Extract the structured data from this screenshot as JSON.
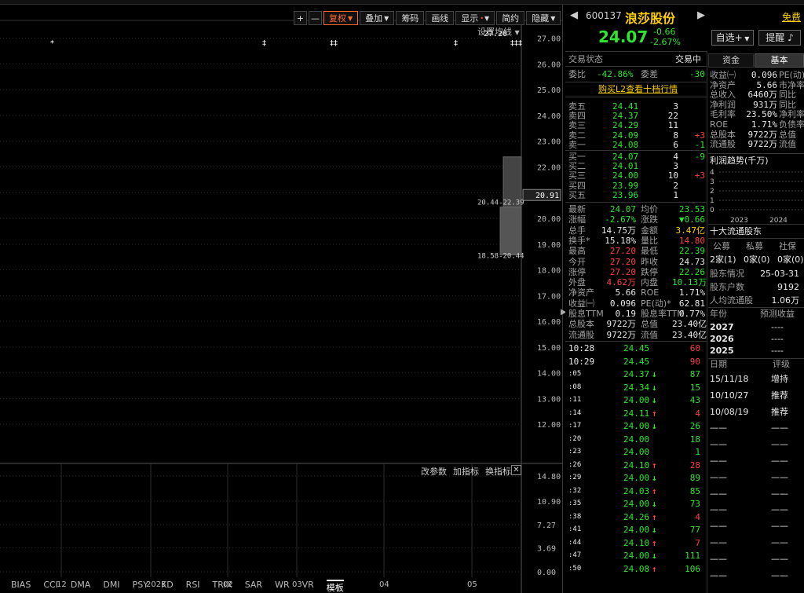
{
  "toolbar": {
    "plus": "+",
    "minus": "—",
    "buttons": [
      "复权",
      "叠加",
      "筹码",
      "画线",
      "显示",
      "简约",
      "隐藏"
    ],
    "settings_label": "设置均线"
  },
  "kline": {
    "ymin": 11.0,
    "ymax": 27.6,
    "y_ticks": [
      "27.00",
      "26.00",
      "25.00",
      "24.00",
      "23.00",
      "22.00",
      "21.00",
      "20.00",
      "19.00",
      "18.00",
      "17.00",
      "16.00",
      "15.00",
      "14.00",
      "13.00",
      "12.00"
    ],
    "current_price_tag": "20.91",
    "annotations": {
      "high": "27.20",
      "mid": "20.44-22.39",
      "low": "18.58-20.44"
    },
    "markers": [
      "*",
      "‡",
      "‡‡",
      "‡",
      "‡‡‡"
    ],
    "x_labels": [
      "12",
      "2025",
      "02",
      "03",
      "04",
      "05"
    ],
    "candles": []
  },
  "volume": {
    "ymax": 14.8,
    "y_ticks": [
      "14.80",
      "10.90",
      "7.27",
      "3.69",
      "0.00"
    ],
    "toolbar": [
      "改参数",
      "加指标",
      "换指标"
    ]
  },
  "indicator_tabs": [
    "BIAS",
    "CCI",
    "DMA",
    "DMI",
    "PSY",
    "KD",
    "RSI",
    "TRIX",
    "SAR",
    "WR",
    "VR",
    "模板"
  ],
  "stock": {
    "code": "600137",
    "name": "浪莎股份",
    "free_label": "免费",
    "price": "24.07",
    "change": "-0.66",
    "change_pct": "-2.67%",
    "btn_watch": "自选+",
    "btn_alert": "提醒"
  },
  "status": {
    "label": "交易状态",
    "value": "交易中"
  },
  "weibi": {
    "label1": "委比",
    "value1": "-42.86%",
    "label2": "委差",
    "value2": "-30"
  },
  "l2_link": "购买L2查看十档行情",
  "asks": [
    {
      "label": "卖五",
      "price": "24.41",
      "vol": "3",
      "chg": ""
    },
    {
      "label": "卖四",
      "price": "24.37",
      "vol": "22",
      "chg": ""
    },
    {
      "label": "卖三",
      "price": "24.29",
      "vol": "11",
      "chg": ""
    },
    {
      "label": "卖二",
      "price": "24.09",
      "vol": "8",
      "chg": "+3"
    },
    {
      "label": "卖一",
      "price": "24.08",
      "vol": "6",
      "chg": "-1"
    }
  ],
  "bids": [
    {
      "label": "买一",
      "price": "24.07",
      "vol": "4",
      "chg": "-9"
    },
    {
      "label": "买二",
      "price": "24.01",
      "vol": "3",
      "chg": ""
    },
    {
      "label": "买三",
      "price": "24.00",
      "vol": "10",
      "chg": "+3"
    },
    {
      "label": "买四",
      "price": "23.99",
      "vol": "2",
      "chg": ""
    },
    {
      "label": "买五",
      "price": "23.96",
      "vol": "1",
      "chg": ""
    }
  ],
  "quote": [
    {
      "l1": "最新",
      "v1": "24.07",
      "c1": "green",
      "l2": "均价",
      "v2": "23.53",
      "c2": "green"
    },
    {
      "l1": "涨幅",
      "v1": "-2.67%",
      "c1": "green",
      "l2": "涨跌",
      "v2": "▼0.66",
      "c2": "green"
    },
    {
      "l1": "总手",
      "v1": "14.75万",
      "c1": "white",
      "l2": "金额",
      "v2": "3.47亿",
      "c2": "yellow"
    },
    {
      "l1": "换手*",
      "v1": "15.18%",
      "c1": "white",
      "l2": "量比",
      "v2": "14.80",
      "c2": "red"
    },
    {
      "l1": "最高",
      "v1": "27.20",
      "c1": "red",
      "l2": "最低",
      "v2": "22.39",
      "c2": "green"
    },
    {
      "l1": "今开",
      "v1": "27.20",
      "c1": "red",
      "l2": "昨收",
      "v2": "24.73",
      "c2": "white"
    },
    {
      "l1": "涨停",
      "v1": "27.20",
      "c1": "red",
      "l2": "跌停",
      "v2": "22.26",
      "c2": "green"
    },
    {
      "l1": "外盘",
      "v1": "4.62万",
      "c1": "red",
      "l2": "内盘",
      "v2": "10.13万",
      "c2": "green"
    },
    {
      "l1": "净资产",
      "v1": "5.66",
      "c1": "white",
      "l2": "ROE",
      "v2": "1.71%",
      "c2": "white"
    },
    {
      "l1": "收益㈠",
      "v1": "0.096",
      "c1": "white",
      "l2": "PE(动)*",
      "v2": "62.81",
      "c2": "white"
    },
    {
      "l1": "股息TTM",
      "v1": "0.19",
      "c1": "white",
      "l2": "股息率TTM",
      "v2": "0.77%",
      "c2": "white"
    },
    {
      "l1": "总股本",
      "v1": "9722万",
      "c1": "white",
      "l2": "总值",
      "v2": "23.40亿",
      "c2": "white"
    },
    {
      "l1": "流通股",
      "v1": "9722万",
      "c1": "white",
      "l2": "流值",
      "v2": "23.40亿",
      "c2": "white"
    }
  ],
  "ticks": [
    {
      "t": "10:28",
      "p": "24.45",
      "a": "",
      "v": "60",
      "vc": "red",
      "big": true
    },
    {
      "t": "10:29",
      "p": "24.45",
      "a": "",
      "v": "90",
      "vc": "red",
      "big": true
    },
    {
      "t": ":05",
      "p": "24.37",
      "a": "↓",
      "v": "87",
      "vc": "green"
    },
    {
      "t": ":08",
      "p": "24.34",
      "a": "↓",
      "v": "15",
      "vc": "green"
    },
    {
      "t": ":11",
      "p": "24.00",
      "a": "↓",
      "v": "43",
      "vc": "green"
    },
    {
      "t": ":14",
      "p": "24.11",
      "a": "↑",
      "v": "4",
      "vc": "red"
    },
    {
      "t": ":17",
      "p": "24.00",
      "a": "↓",
      "v": "26",
      "vc": "green"
    },
    {
      "t": ":20",
      "p": "24.00",
      "a": "",
      "v": "18",
      "vc": "green"
    },
    {
      "t": ":23",
      "p": "24.00",
      "a": "",
      "v": "1",
      "vc": "green"
    },
    {
      "t": ":26",
      "p": "24.10",
      "a": "↑",
      "v": "28",
      "vc": "red"
    },
    {
      "t": ":29",
      "p": "24.00",
      "a": "↓",
      "v": "89",
      "vc": "green"
    },
    {
      "t": ":32",
      "p": "24.03",
      "a": "↑",
      "v": "85",
      "vc": "green"
    },
    {
      "t": ":35",
      "p": "24.00",
      "a": "↓",
      "v": "73",
      "vc": "green"
    },
    {
      "t": ":38",
      "p": "24.26",
      "a": "↑",
      "v": "4",
      "vc": "red"
    },
    {
      "t": ":41",
      "p": "24.00",
      "a": "↓",
      "v": "77",
      "vc": "green"
    },
    {
      "t": ":44",
      "p": "24.10",
      "a": "↑",
      "v": "7",
      "vc": "red"
    },
    {
      "t": ":47",
      "p": "24.00",
      "a": "↓",
      "v": "111",
      "vc": "green"
    },
    {
      "t": ":50",
      "p": "24.08",
      "a": "↑",
      "v": "106",
      "vc": "green"
    }
  ],
  "far_right": {
    "tabs": [
      "资金",
      "基本"
    ],
    "fund_rows": [
      {
        "l": "收益㈠",
        "v": "0.096",
        "x": "PE(动)"
      },
      {
        "l": "净资产",
        "v": "5.66",
        "x": "市净率"
      },
      {
        "l": "总收入",
        "v": "6460万",
        "x": "同比"
      },
      {
        "l": "净利润",
        "v": "931万",
        "x": "同比"
      },
      {
        "l": "毛利率",
        "v": "23.50%",
        "x": "净利率"
      },
      {
        "l": "ROE",
        "v": "1.71%",
        "x": "负债率"
      },
      {
        "l": "总股本",
        "v": "9722万",
        "x": "总值"
      },
      {
        "l": "流通股",
        "v": "9722万",
        "x": "流值"
      }
    ],
    "profit_title": "利润趋势(千万)",
    "profit_y": [
      "4",
      "3",
      "2",
      "1",
      "0"
    ],
    "profit_x": [
      "2023",
      "2024"
    ],
    "holders_title": "十大流通股东",
    "holder_heads": [
      "公募",
      "私募",
      "社保"
    ],
    "holder_vals": [
      "2家(1)",
      "0家(0)",
      "0家(0)"
    ],
    "holder_rows": [
      {
        "l": "股东情况",
        "v": "25-03-31"
      },
      {
        "l": "股东户数",
        "v": "9192"
      },
      {
        "l": "人均流通股",
        "v": "1.06万"
      }
    ],
    "eps_heads": [
      "年份",
      "预测收益"
    ],
    "eps_rows": [
      {
        "y": "2027",
        "v": "----"
      },
      {
        "y": "2026",
        "v": "----"
      },
      {
        "y": "2025",
        "v": "----"
      }
    ],
    "rating_heads": [
      "日期",
      "评级"
    ],
    "rating_rows": [
      {
        "d": "15/11/18",
        "r": "增持"
      },
      {
        "d": "10/10/27",
        "r": "推荐"
      },
      {
        "d": "10/08/19",
        "r": "推荐"
      },
      {
        "d": "——",
        "r": "——"
      },
      {
        "d": "——",
        "r": "——"
      },
      {
        "d": "——",
        "r": "——"
      },
      {
        "d": "——",
        "r": "——"
      },
      {
        "d": "——",
        "r": "——"
      },
      {
        "d": "——",
        "r": "——"
      },
      {
        "d": "——",
        "r": "——"
      },
      {
        "d": "——",
        "r": "——"
      },
      {
        "d": "——",
        "r": "——"
      },
      {
        "d": "——",
        "r": "——"
      }
    ]
  },
  "colors": {
    "up": "#ff3b3b",
    "down": "#00e0e0",
    "ma1": "#ffd24a",
    "ma2": "#d040d0",
    "accent": "#ff6a2a"
  }
}
